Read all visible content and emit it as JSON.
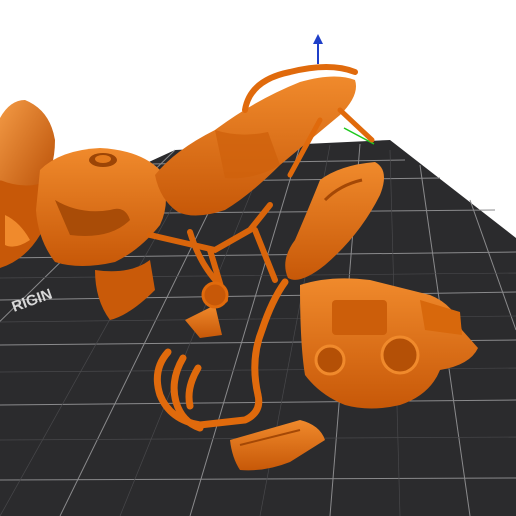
{
  "viewport": {
    "background": "#ffffff",
    "bed_color": "#2b2b2d",
    "grid_color": "#8c8c8e",
    "bed_label": "RIGIN",
    "axis_color": "#1f3fc8",
    "axis_icon": "z-axis-arrow-icon"
  },
  "model": {
    "parts": [
      "fairing",
      "fuel-tank",
      "seat",
      "subframe",
      "frame",
      "swingarm",
      "exhaust-headers",
      "exhaust-silencer",
      "engine",
      "skid-plate",
      "footpeg-bracket"
    ],
    "color": "#e06a0c",
    "shade_color": "#a84a06",
    "highlight_color": "#f49a44"
  }
}
